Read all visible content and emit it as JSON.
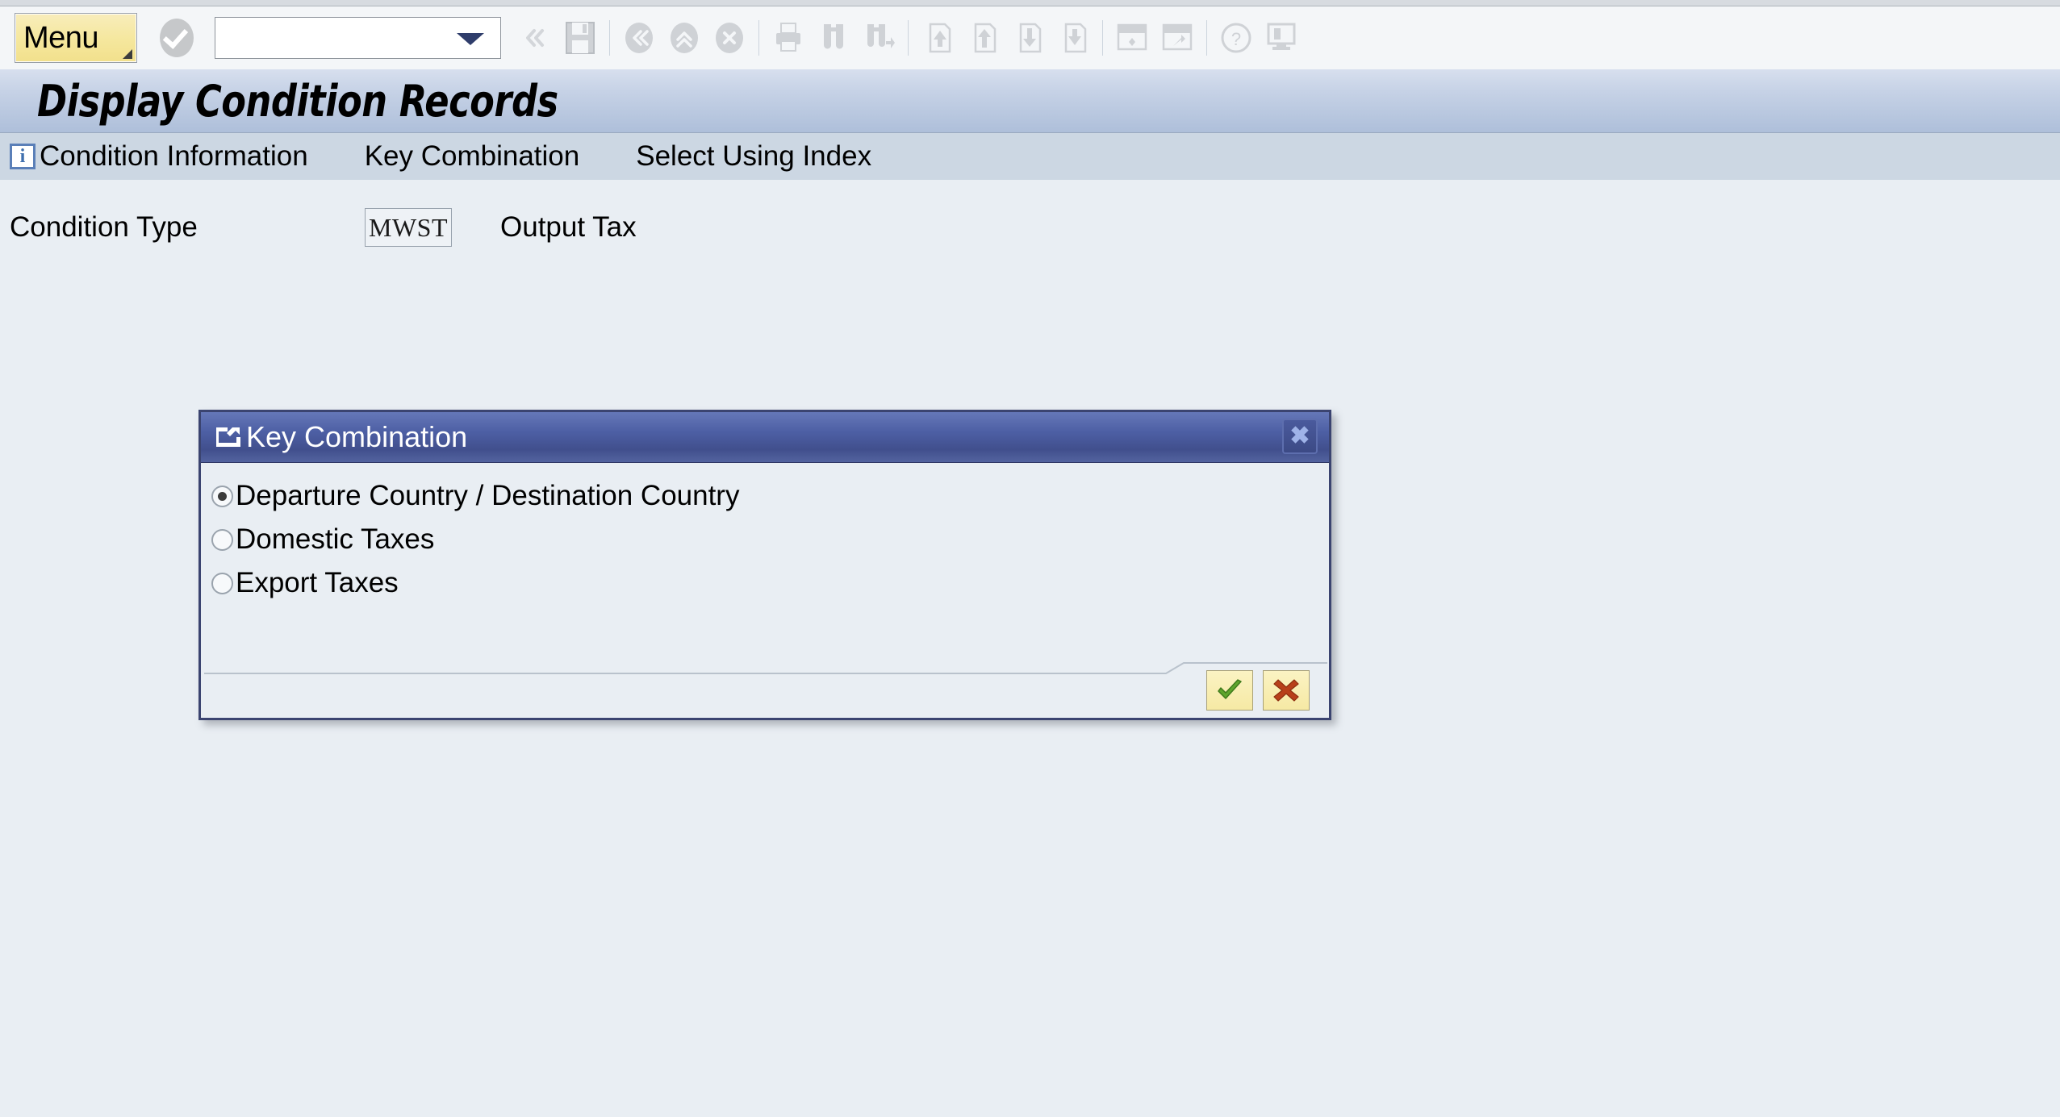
{
  "toolbar": {
    "menu_label": "Menu",
    "command_value": "",
    "command_placeholder": "",
    "icons": [
      {
        "name": "confirm-check-icon"
      },
      {
        "name": "back-icon"
      },
      {
        "name": "exit-icon"
      },
      {
        "name": "cancel-icon"
      },
      {
        "name": "print-icon"
      },
      {
        "name": "find-icon"
      },
      {
        "name": "find-next-icon"
      },
      {
        "name": "first-page-icon"
      },
      {
        "name": "previous-page-icon"
      },
      {
        "name": "next-page-icon"
      },
      {
        "name": "last-page-icon"
      },
      {
        "name": "create-session-icon"
      },
      {
        "name": "create-shortcut-icon"
      },
      {
        "name": "help-icon"
      },
      {
        "name": "customize-local-layout-icon"
      }
    ]
  },
  "program": {
    "title": "Display Condition Records"
  },
  "app_menu": [
    {
      "label": "Condition Information",
      "icon": "info-icon"
    },
    {
      "label": "Key Combination",
      "icon": ""
    },
    {
      "label": "Select Using Index",
      "icon": ""
    }
  ],
  "form": {
    "condition_type_label": "Condition Type",
    "condition_type_value": "MWST",
    "condition_type_description": "Output Tax"
  },
  "dialog": {
    "title": "Key Combination",
    "close_label": "✖",
    "options": [
      {
        "label": "Departure Country / Destination Country",
        "selected": true
      },
      {
        "label": "Domestic Taxes",
        "selected": false
      },
      {
        "label": "Export Taxes",
        "selected": false
      }
    ],
    "buttons": [
      {
        "name": "confirm-button",
        "icon": "green-check-icon"
      },
      {
        "name": "cancel-button",
        "icon": "red-cross-icon"
      }
    ]
  },
  "colors": {
    "background": "#e9eef3",
    "menubar": "#ccd7e3",
    "dialog_border": "#3b4470",
    "dialog_titlebar": "#4d5fa4",
    "menu_button": "#f5e79d",
    "accent_blue": "#5a7fb8"
  }
}
